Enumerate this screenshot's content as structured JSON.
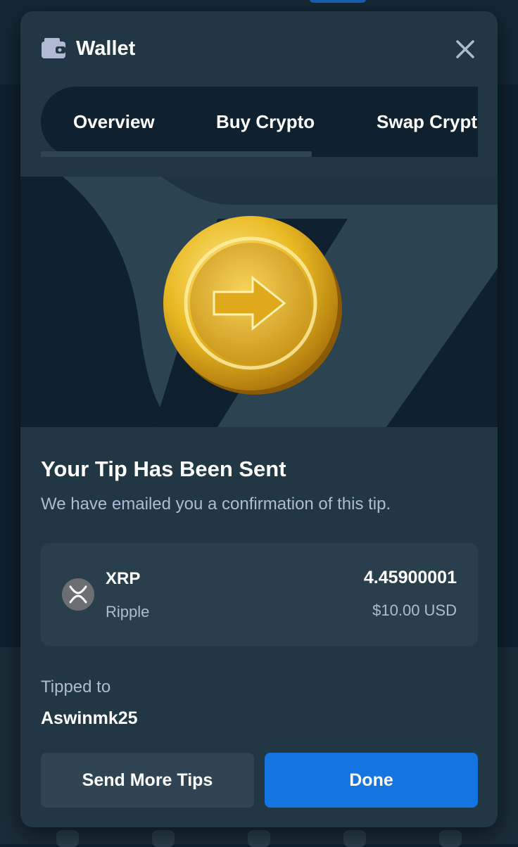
{
  "colors": {
    "modal_bg": "#213743",
    "tab_bar_bg": "#0f212e",
    "hero_bg": "#2c4452",
    "card_bg": "#2a3f4c",
    "primary": "#1475e1",
    "secondary": "#2f4553",
    "text_primary": "#ffffff",
    "text_secondary": "#b1bad3",
    "coin_gold": "#e8b923"
  },
  "header": {
    "icon": "wallet-icon",
    "title": "Wallet",
    "close_icon": "close-icon"
  },
  "tabs": [
    {
      "label": "Overview",
      "active": true
    },
    {
      "label": "Buy Crypto",
      "active": false
    },
    {
      "label": "Swap Crypto",
      "active": false
    }
  ],
  "hero": {
    "icon": "gold-coin-arrow-icon"
  },
  "confirmation": {
    "title": "Your Tip Has Been Sent",
    "subtitle": "We have emailed you a confirmation of this tip."
  },
  "transaction": {
    "coin_icon": "xrp-icon",
    "symbol": "XRP",
    "name": "Ripple",
    "amount": "4.45900001",
    "usd_value": "$10.00 USD"
  },
  "recipient": {
    "label": "Tipped to",
    "username": "Aswinmk25"
  },
  "actions": {
    "send_more_label": "Send More Tips",
    "done_label": "Done"
  }
}
